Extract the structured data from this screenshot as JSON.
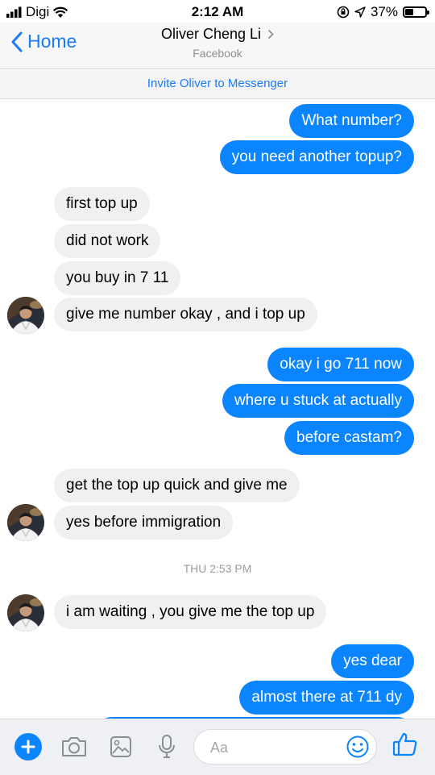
{
  "status_bar": {
    "carrier": "Digi",
    "time": "2:12 AM",
    "battery": "37%",
    "battery_level": 0.37
  },
  "header": {
    "back_label": "Home",
    "contact_name": "Oliver Cheng Li",
    "subtitle": "Facebook"
  },
  "invite_banner": "Invite Oliver to Messenger",
  "messages": [
    {
      "text": "What number?",
      "from": "me"
    },
    {
      "text": "you need another topup?",
      "from": "me"
    },
    {
      "text": "first top up",
      "from": "them"
    },
    {
      "text": "did not work",
      "from": "them"
    },
    {
      "text": "you buy in 7 11",
      "from": "them"
    },
    {
      "text": "give me number okay , and i top up",
      "from": "them"
    },
    {
      "text": "okay i go 711 now",
      "from": "me"
    },
    {
      "text": "where u stuck at actually",
      "from": "me"
    },
    {
      "text": "before castam?",
      "from": "me"
    },
    {
      "text": "get the top up quick and give me",
      "from": "them"
    },
    {
      "text": "yes before immigration",
      "from": "them"
    },
    {
      "text": "i am waiting , you give me the top up",
      "from": "them"
    },
    {
      "text": "yes dear",
      "from": "me"
    },
    {
      "text": "almost there at 711 dy",
      "from": "me"
    },
    {
      "text": "",
      "from": "me"
    }
  ],
  "timestamp": "THU 2:53 PM",
  "composer": {
    "placeholder": "Aa"
  },
  "colors": {
    "accent": "#0a84ff",
    "incoming_bubble": "#f0f0f0"
  }
}
